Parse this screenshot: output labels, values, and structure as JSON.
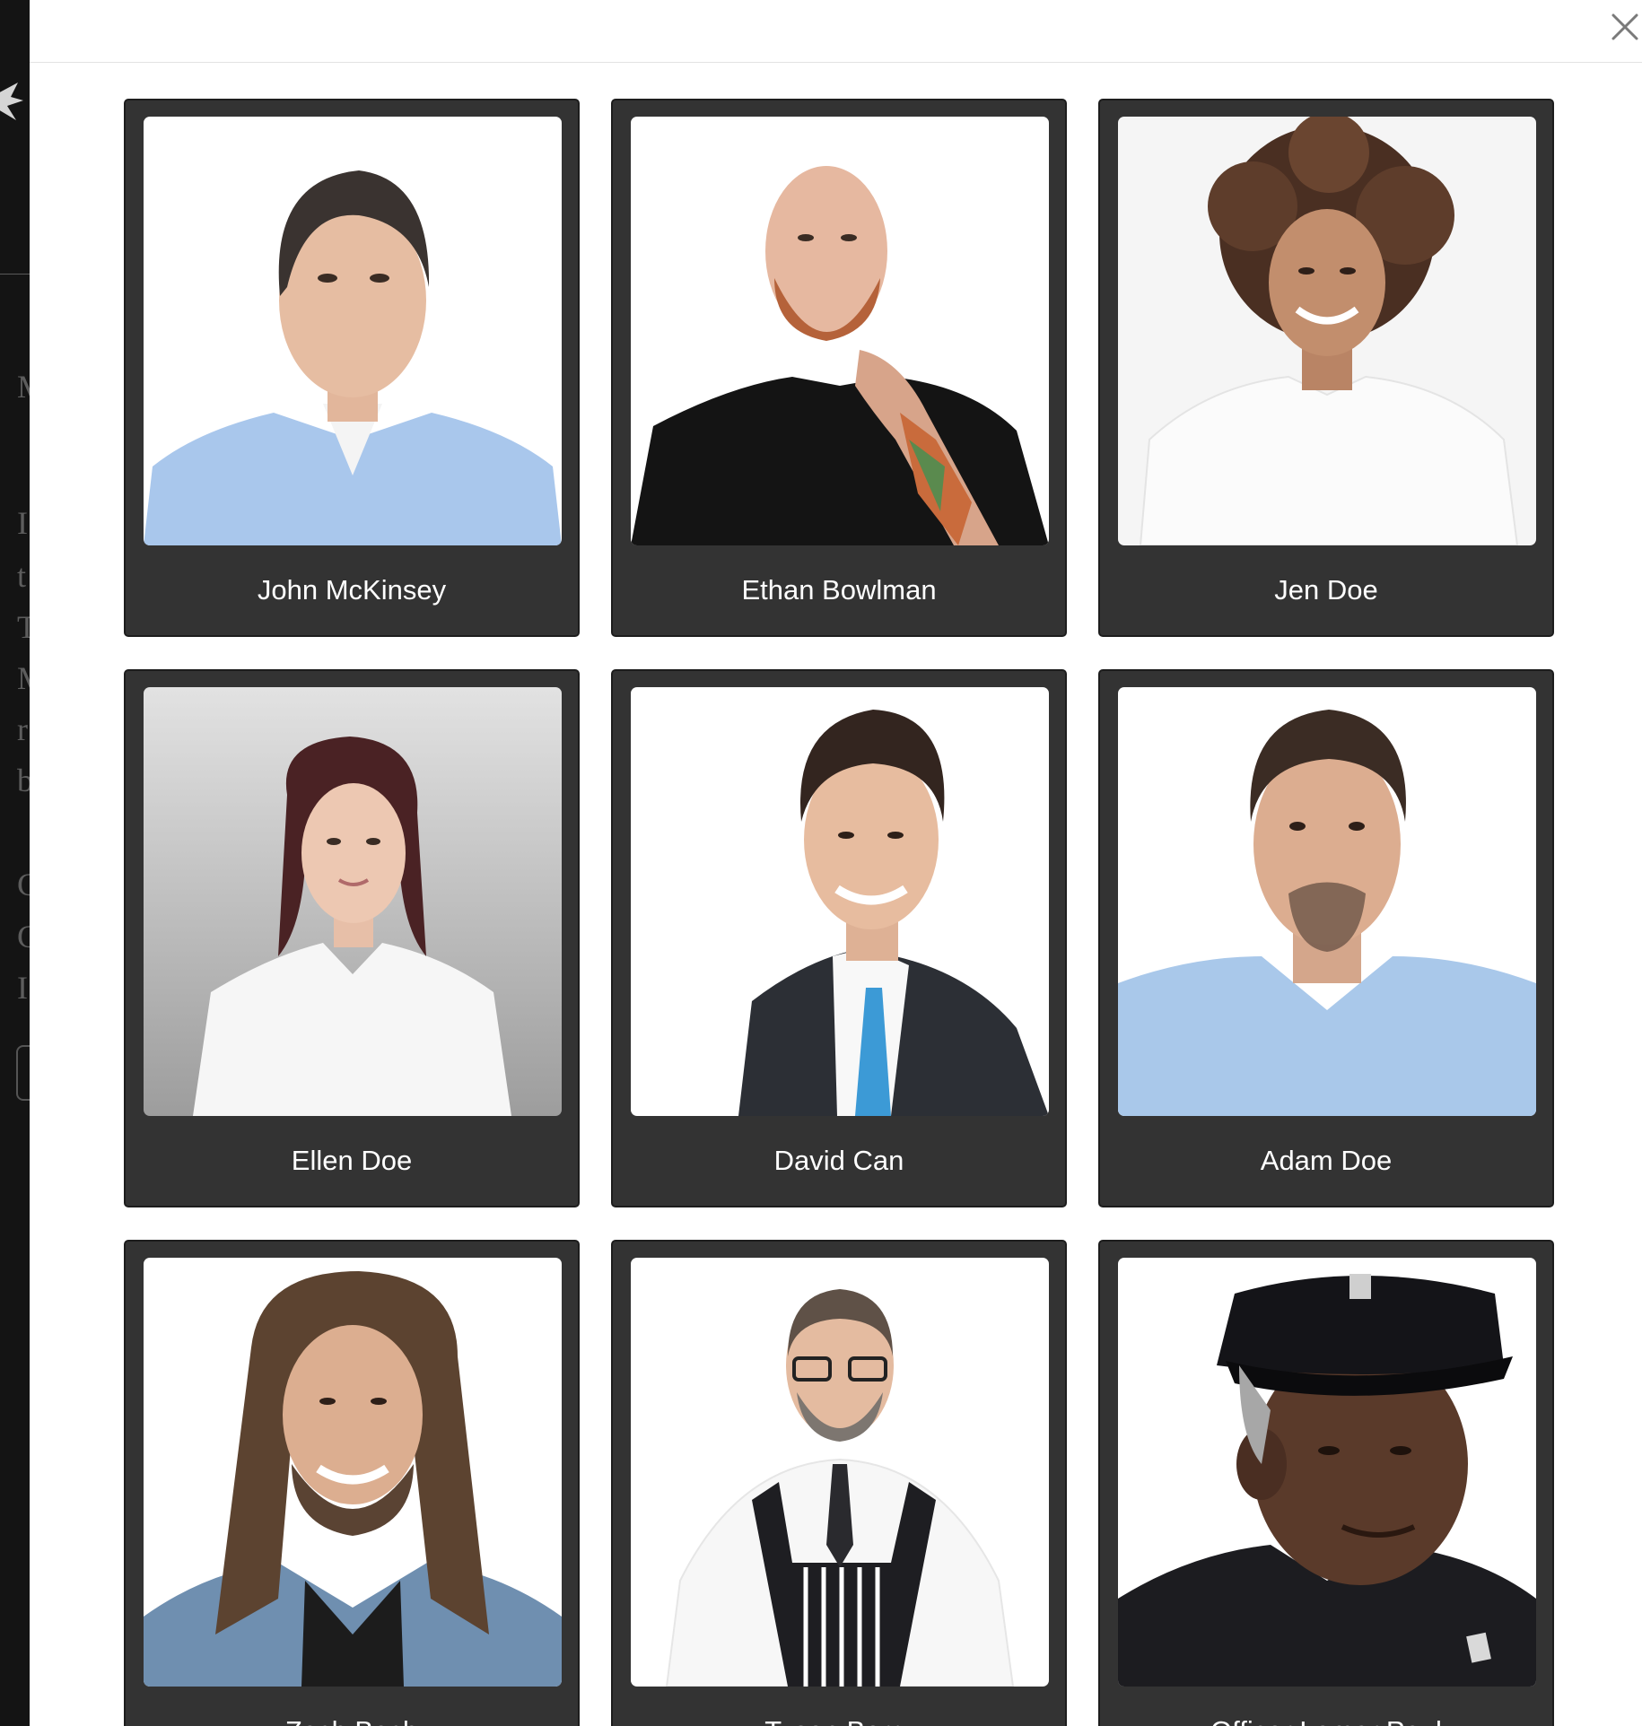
{
  "background_page": {
    "side_letters": [
      "M",
      "I",
      "t",
      "T",
      "M",
      "r",
      "b",
      "C",
      "C",
      "I"
    ]
  },
  "modal": {
    "close_icon": "close-icon",
    "people": [
      {
        "name": "John McKinsey",
        "image": "portrait-man-blue-shirt"
      },
      {
        "name": "Ethan Bowlman",
        "image": "portrait-bald-bearded-man-tattoo"
      },
      {
        "name": "Jen Doe",
        "image": "portrait-woman-curly-hair"
      },
      {
        "name": "Ellen Doe",
        "image": "portrait-woman-white-blouse"
      },
      {
        "name": "David Can",
        "image": "portrait-man-suit-blue-tie"
      },
      {
        "name": "Adam Doe",
        "image": "portrait-man-light-blue-tee"
      },
      {
        "name": "Zach Bach",
        "image": "portrait-man-long-hair-denim"
      },
      {
        "name": "Tyson Berry",
        "image": "portrait-man-glasses-apron"
      },
      {
        "name": "Officer Lamar Paul",
        "image": "portrait-police-officer"
      }
    ]
  }
}
